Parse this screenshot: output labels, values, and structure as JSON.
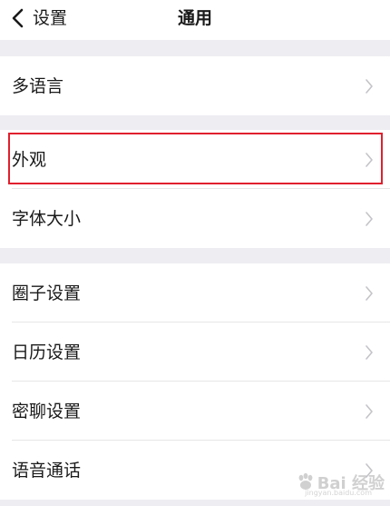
{
  "nav": {
    "back_label": "设置",
    "title": "通用"
  },
  "groups": [
    {
      "items": [
        {
          "label": "多语言"
        }
      ]
    },
    {
      "items": [
        {
          "label": "外观",
          "highlighted": true
        },
        {
          "label": "字体大小"
        }
      ]
    },
    {
      "items": [
        {
          "label": "圈子设置"
        },
        {
          "label": "日历设置"
        },
        {
          "label": "密聊设置"
        },
        {
          "label": "语音通话"
        }
      ]
    }
  ],
  "colors": {
    "background": "#ededf2",
    "highlight_border": "#e0202e",
    "chevron": "#c4c4c8"
  },
  "icons": {
    "back": "chevron-left-icon",
    "row_arrow": "chevron-right-icon"
  },
  "watermark": {
    "text": "Bai 经验",
    "sub": "jingyan.baidu.com"
  }
}
